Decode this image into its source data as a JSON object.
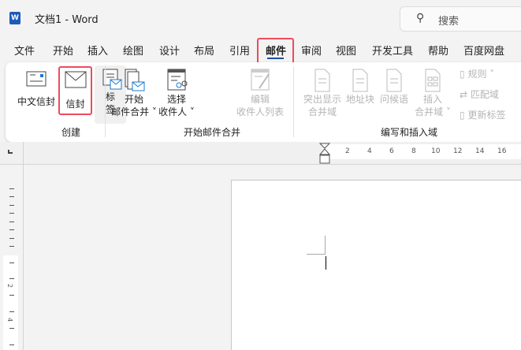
{
  "title": {
    "doc": "文档1  -  Word",
    "logo": "W"
  },
  "search": {
    "placeholder": "搜索"
  },
  "tabs": [
    "文件",
    "开始",
    "插入",
    "绘图",
    "设计",
    "布局",
    "引用",
    "邮件",
    "审阅",
    "视图",
    "开发工具",
    "帮助",
    "百度网盘"
  ],
  "active_tab": "邮件",
  "ribbon": {
    "create": {
      "label": "创建",
      "chinese_envelope": "中文信封",
      "envelope": "信封",
      "labels_1": "标",
      "labels_2": "签"
    },
    "merge": {
      "label": "开始邮件合并",
      "start_1": "开始",
      "start_2": "邮件合并",
      "select_1": "选择",
      "select_2": "收件人",
      "edit_1": "编辑",
      "edit_2": "收件人列表"
    },
    "fields": {
      "label": "编写和插入域",
      "highlight_1": "突出显示",
      "highlight_2": "合并域",
      "address": "地址块",
      "greeting": "问候语",
      "insert_1": "插入",
      "insert_2": "合并域",
      "rules": "规则",
      "match": "匹配域",
      "update": "更新标签"
    }
  },
  "ruler": {
    "h": [
      "2",
      "4",
      "6",
      "8",
      "10",
      "12",
      "14",
      "16"
    ],
    "v": [
      "2",
      "4"
    ]
  }
}
